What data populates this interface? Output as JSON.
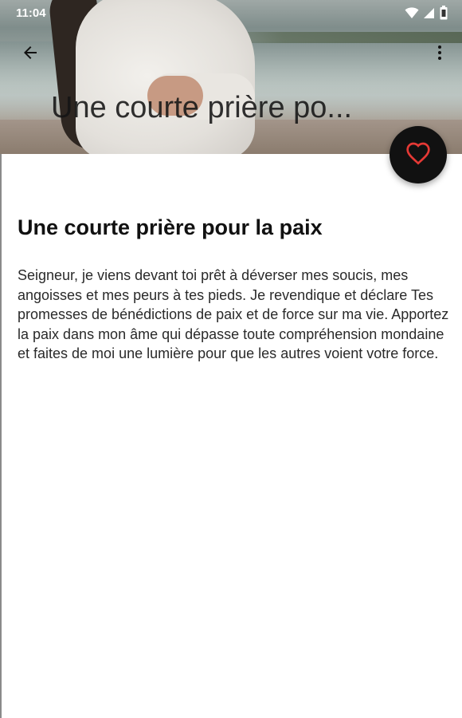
{
  "status_bar": {
    "time": "11:04",
    "icons": [
      "wifi-icon",
      "signal-icon",
      "battery-icon"
    ]
  },
  "toolbar": {
    "back_icon": "arrow-left-icon",
    "title": "Une courte prière po...",
    "menu_icon": "more-vert-icon"
  },
  "fab": {
    "icon": "heart-icon",
    "icon_color": "#e53935"
  },
  "content": {
    "title": "Une courte prière pour la paix",
    "body": "Seigneur, je viens devant toi prêt à déverser mes soucis, mes angoisses et mes peurs à tes pieds. Je revendique et déclare Tes promesses de bénédictions de paix et de force sur ma vie. Apportez la paix dans mon âme qui dépasse toute compréhension mondaine et faites de moi une lumière pour que les autres voient votre force."
  },
  "colors": {
    "fab_background": "#111111",
    "text": "#2a2a2a"
  }
}
